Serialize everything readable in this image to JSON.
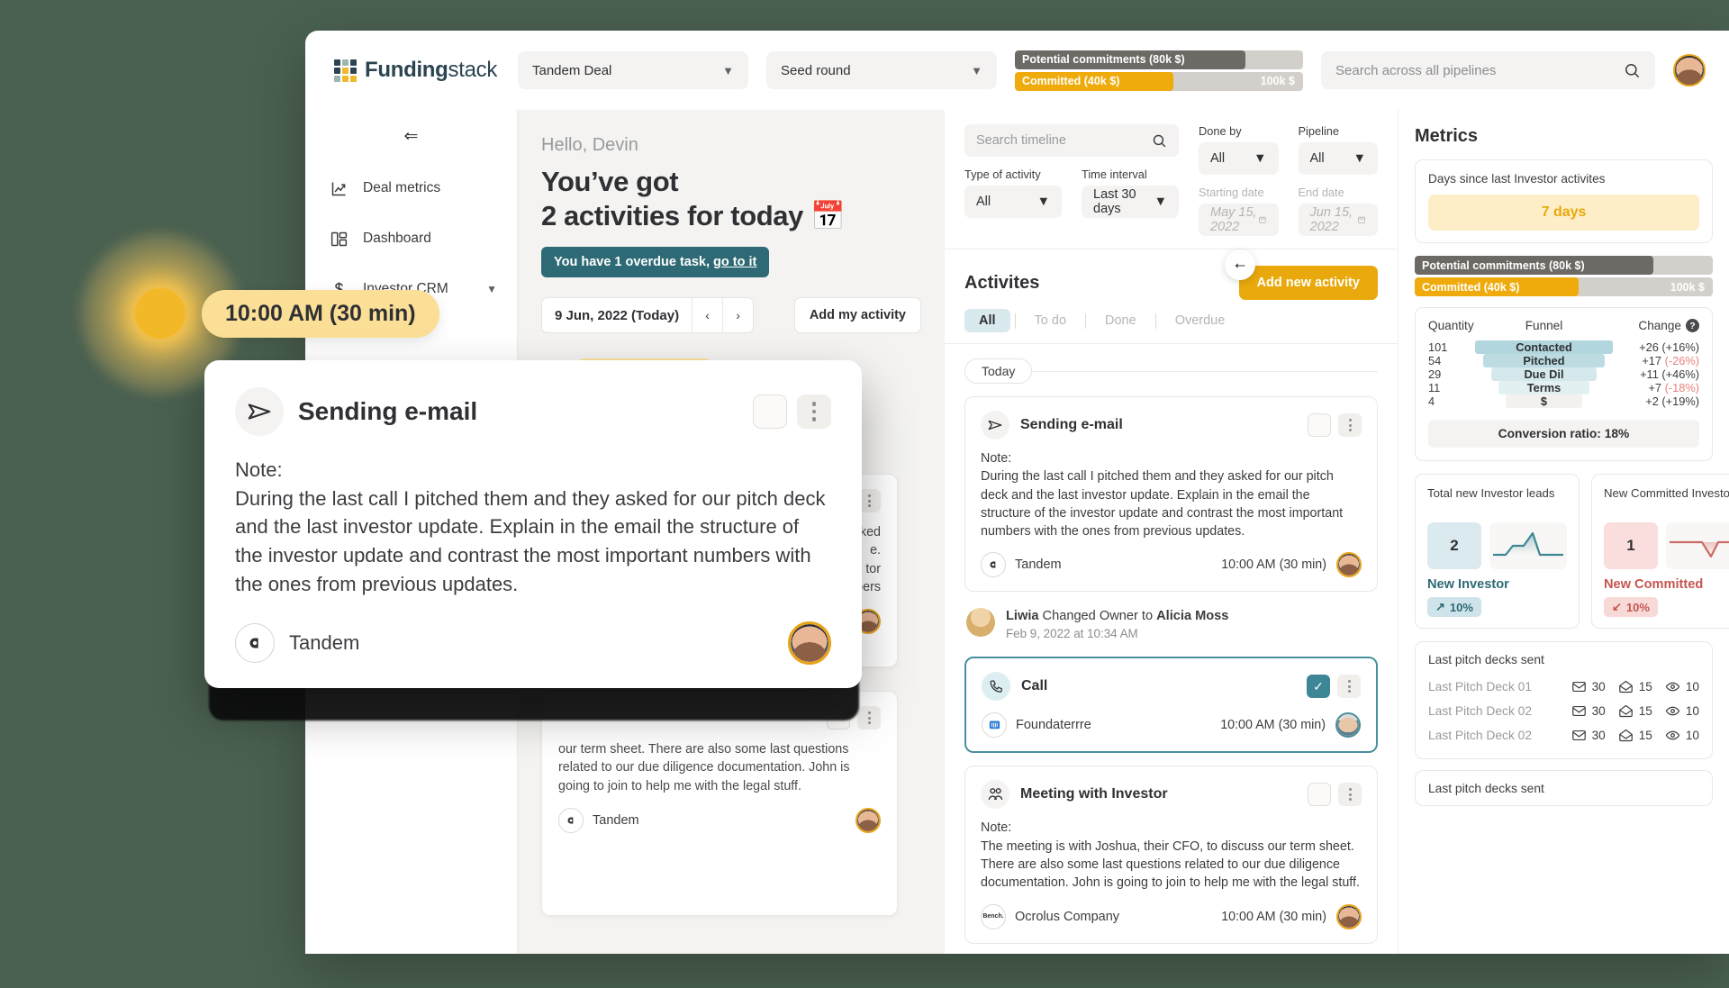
{
  "brand": {
    "name_bold": "Funding",
    "name_light": "stack",
    "logo_colors": [
      "#2b4450",
      "#9ab7b2",
      "#2b4450",
      "#2b4450",
      "#f0b82c",
      "#2b4450",
      "#9ab7b2",
      "#f0b82c",
      "#f0b82c"
    ]
  },
  "topbar": {
    "deal_select": "Tandem Deal",
    "round_select": "Seed round",
    "potential_label": "Potential commitments (80k $)",
    "committed_label": "Committed (40k $)",
    "scale_max": "100k $",
    "search_placeholder": "Search across all pipelines"
  },
  "sidebar": {
    "collapse_icon": "⇐",
    "items": [
      {
        "label": "Deal metrics",
        "icon": "chart-up-icon",
        "has_chevron": false
      },
      {
        "label": "Dashboard",
        "icon": "dashboard-icon",
        "has_chevron": false
      },
      {
        "label": "Investor CRM",
        "icon": "dollar-icon",
        "has_chevron": true
      }
    ]
  },
  "hello": {
    "greeting": "Hello, Devin",
    "title_line1": "You’ve got",
    "title_line2": "2 activities for today 📅",
    "overdue_text": "You have 1 overdue task,",
    "overdue_link": "go to it",
    "date": "9 Jun, 2022 (Today)",
    "prev": "‹",
    "next": "›",
    "add_my_activity": "Add my activity",
    "time_chip": "10:00 AM (30 min)",
    "ghost_card_note": "sked\ne.\ntor\nnbers",
    "ghost_card2_note": "our term sheet. There are also some last questions related to our due diligence documentation. John is going to join to help me with the legal stuff.",
    "ghost_card2_org": "Tandem"
  },
  "float_chip": "10:00 AM (30 min)",
  "filters": {
    "search_placeholder": "Search timeline",
    "type_label": "Type of activity",
    "type_value": "All",
    "interval_label": "Time interval",
    "interval_value": "Last 30 days",
    "done_by_label": "Done by",
    "done_by_value": "All",
    "pipeline_label": "Pipeline",
    "pipeline_value": "All",
    "start_label": "Starting date",
    "start_value": "May 15, 2022",
    "end_label": "End date",
    "end_value": "Jun 15, 2022"
  },
  "timeline": {
    "title": "Activites",
    "add_button": "Add new activity",
    "tabs": [
      {
        "label": "All",
        "active": true
      },
      {
        "label": "To do",
        "active": false
      },
      {
        "label": "Done",
        "active": false
      },
      {
        "label": "Overdue",
        "active": false
      }
    ],
    "day_separator": "Today",
    "cards": [
      {
        "type": "Sending e-mail",
        "icon": "paper-plane-icon",
        "note_label": "Note:",
        "note": "During the last call I pitched them and they asked for our pitch deck and the last investor update. Explain in the email the structure of the investor update and contrast the most important numbers with the ones from previous updates.",
        "org": "Tandem",
        "time": "10:00 AM (30 min)",
        "checked": false,
        "selected": false
      },
      {
        "type": "Call",
        "icon": "phone-icon",
        "note_label": "",
        "note": "",
        "org": "Foundaterrre",
        "time": "10:00 AM (30 min)",
        "checked": true,
        "selected": true
      },
      {
        "type": "Meeting with Investor",
        "icon": "people-icon",
        "note_label": "Note:",
        "note": "The meeting is with Joshua, their CFO, to discuss our term sheet. There are also some last questions related to our due diligence documentation. John is going to join to help me with the legal stuff.",
        "org": "Ocrolus Company",
        "time": "10:00 AM (30 min)",
        "checked": false,
        "selected": false
      }
    ],
    "event": {
      "actor": "Liwia",
      "action": " Changed Owner to ",
      "target": "Alicia Moss",
      "date": "Feb 9, 2022 at 10:34 AM"
    }
  },
  "modal": {
    "title": "Sending e-mail",
    "icon": "paper-plane-icon",
    "note_label": "Note:",
    "note": "During the last call I pitched them and they asked for our pitch deck and the last investor update. Explain in the email the structure of the investor update and contrast the most important numbers with the ones from previous updates.",
    "org": "Tandem"
  },
  "metrics": {
    "title": "Metrics",
    "days_label": "Days since last Investor activites",
    "days_value": "7 days",
    "potential_label": "Potential commitments (80k $)",
    "committed_label": "Committed (40k $)",
    "scale_max": "100k $",
    "conversion": "Conversion ratio: 18%",
    "leads": {
      "label": "Total new Investor leads",
      "value": "2",
      "tag": "New Investor",
      "pct": "10%",
      "arrow": "↗"
    },
    "committed": {
      "label": "New Committed Investors",
      "value": "1",
      "tag": "New Committed",
      "pct": "10%",
      "arrow": "↙"
    },
    "decks_title": "Last pitch decks sent",
    "decks_title2": "Last pitch decks sent",
    "decks": [
      {
        "name": "Last Pitch Deck 01",
        "sent": "30",
        "opened": "15",
        "viewed": "10"
      },
      {
        "name": "Last Pitch Deck 02",
        "sent": "30",
        "opened": "15",
        "viewed": "10"
      },
      {
        "name": "Last Pitch Deck 02",
        "sent": "30",
        "opened": "15",
        "viewed": "10"
      }
    ]
  },
  "chart_data": {
    "type": "bar",
    "title": "Funnel",
    "columns": [
      "Quantity",
      "Funnel",
      "Change"
    ],
    "categories": [
      "Contacted",
      "Pitched",
      "Due Dil",
      "Terms",
      "$"
    ],
    "values": [
      101,
      54,
      29,
      11,
      4
    ],
    "bar_widths_pct": [
      100,
      88,
      76,
      66,
      56
    ],
    "bar_colors": [
      "#b2d6de",
      "#bcdce2",
      "#d5e9ed",
      "#e2f0f2",
      "#f2f1ef"
    ],
    "change_abs": [
      "+26",
      "+17",
      "+11",
      "+7",
      "+2"
    ],
    "change_pct": [
      "(+16%)",
      "(-26%)",
      "(+46%)",
      "(-18%)",
      "(+19%)"
    ],
    "change_negative": [
      false,
      true,
      false,
      true,
      false
    ],
    "footer": "Conversion ratio: 18%",
    "xlabel": "",
    "ylabel": "Quantity"
  }
}
